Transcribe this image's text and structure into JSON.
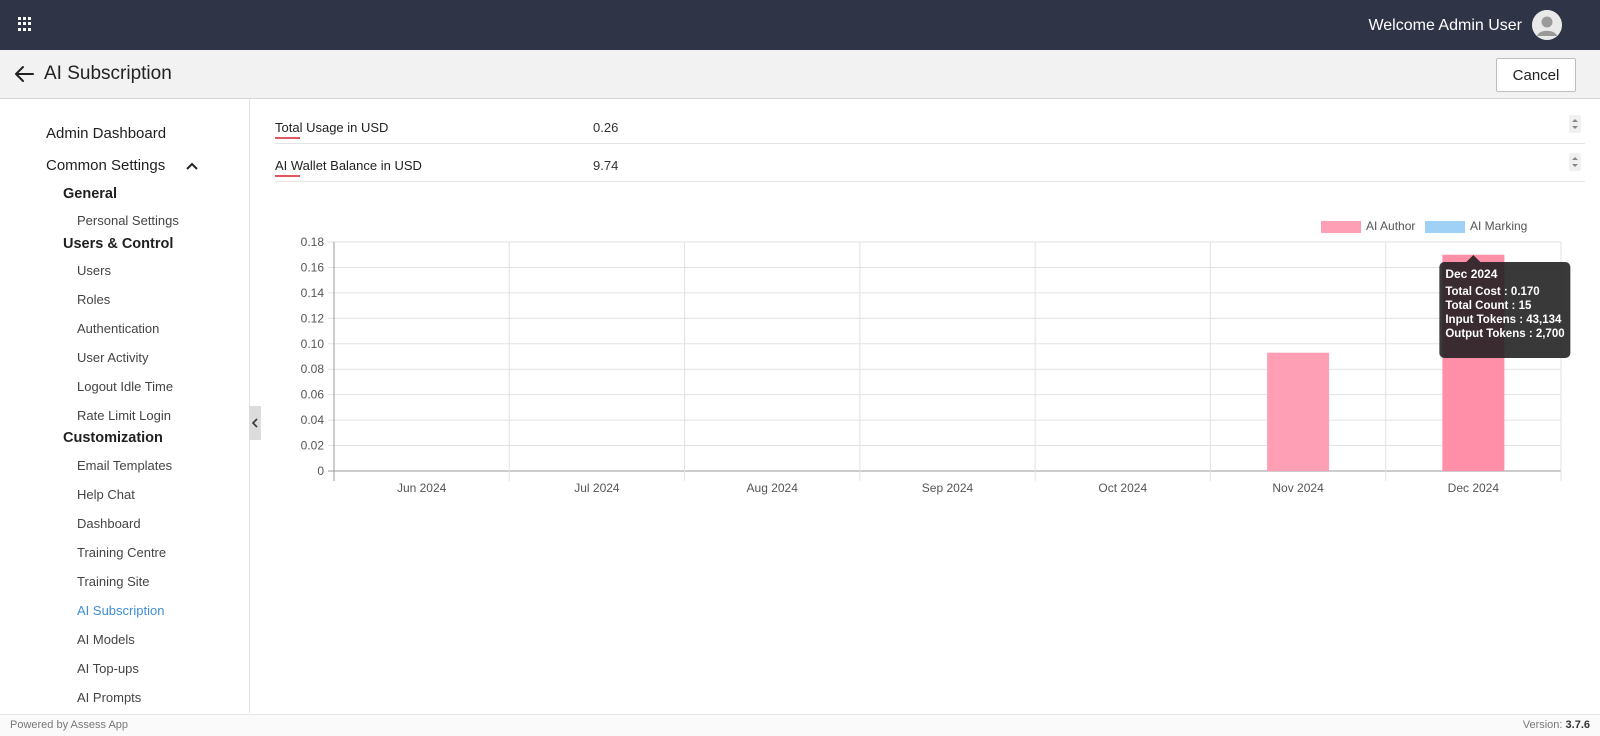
{
  "header": {
    "welcome": "Welcome Admin User"
  },
  "subheader": {
    "title": "AI Subscription",
    "cancel_label": "Cancel"
  },
  "sidebar": {
    "admin_dashboard": "Admin Dashboard",
    "common_settings": "Common Settings",
    "general": "General",
    "personal_settings": "Personal Settings",
    "users_control": "Users & Control",
    "users": "Users",
    "roles": "Roles",
    "authentication": "Authentication",
    "user_activity": "User Activity",
    "logout_idle_time": "Logout Idle Time",
    "rate_limit_login": "Rate Limit Login",
    "customization": "Customization",
    "email_templates": "Email Templates",
    "help_chat": "Help Chat",
    "dashboard": "Dashboard",
    "training_centre": "Training Centre",
    "training_site": "Training Site",
    "ai_subscription": "AI Subscription",
    "ai_models": "AI Models",
    "ai_topups": "AI Top-ups",
    "ai_prompts": "AI Prompts"
  },
  "fields": {
    "total_usage": {
      "label": "Total Usage in USD",
      "value": "0.26"
    },
    "wallet_balance": {
      "label": "AI Wallet Balance in USD",
      "value": "9.74"
    }
  },
  "colors": {
    "ai_author": "#ff9fb6",
    "ai_marking": "#9fd0f5",
    "accent": "#3f8ed4",
    "topbar": "#2f3447"
  },
  "chart_data": {
    "type": "bar",
    "categories": [
      "Jun 2024",
      "Jul 2024",
      "Aug 2024",
      "Sep 2024",
      "Oct 2024",
      "Nov 2024",
      "Dec 2024"
    ],
    "series": [
      {
        "name": "AI Author",
        "values": [
          0,
          0,
          0,
          0,
          0,
          0.093,
          0.17
        ]
      },
      {
        "name": "AI Marking",
        "values": [
          0,
          0,
          0,
          0,
          0,
          0,
          0
        ]
      }
    ],
    "yticks": [
      "0",
      "0.02",
      "0.04",
      "0.06",
      "0.08",
      "0.10",
      "0.12",
      "0.14",
      "0.16",
      "0.18"
    ],
    "ylim": [
      0,
      0.18
    ],
    "grid": true,
    "legend": "top-right",
    "tooltip": {
      "title": "Dec 2024",
      "lines": [
        "Total Cost : 0.170",
        "Total Count : 15",
        "Input Tokens : 43,134",
        "Output Tokens : 2,700"
      ]
    }
  },
  "footer": {
    "powered": "Powered by Assess App",
    "version_label": "Version:",
    "version": "3.7.6"
  }
}
